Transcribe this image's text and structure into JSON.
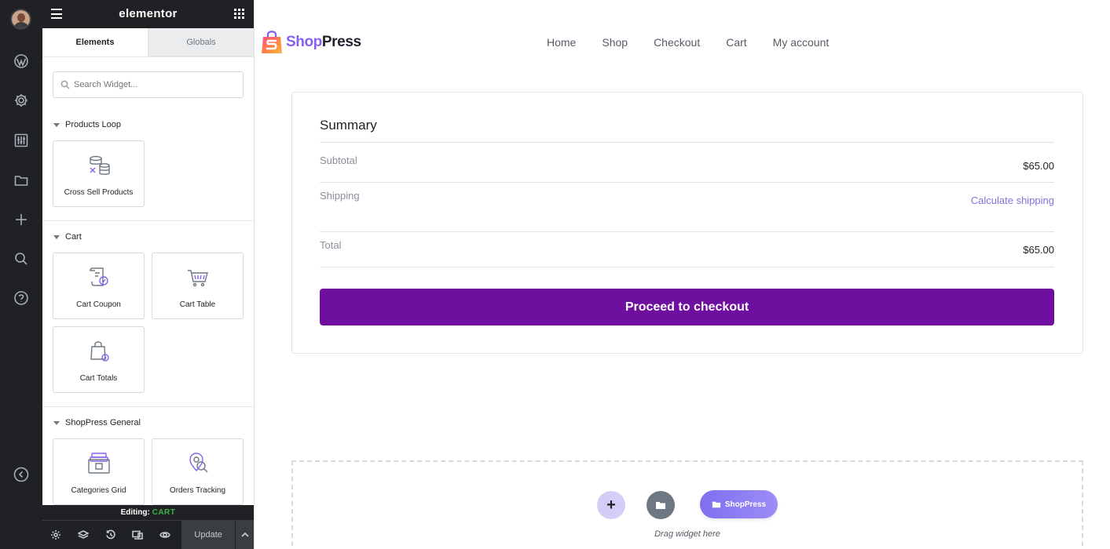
{
  "panel": {
    "brand": "elementor",
    "tabs": [
      "Elements",
      "Globals"
    ],
    "search_placeholder": "Search Widget...",
    "categories": [
      {
        "title": "Products Loop",
        "widgets": [
          "Cross Sell Products"
        ]
      },
      {
        "title": "Cart",
        "widgets": [
          "Cart Coupon",
          "Cart Table",
          "Cart Totals"
        ]
      },
      {
        "title": "ShopPress General",
        "widgets": [
          "Categories Grid",
          "Orders Tracking"
        ]
      }
    ],
    "editing_label": "Editing:",
    "editing_value": "CART",
    "update_label": "Update"
  },
  "site": {
    "logo_shop": "Shop",
    "logo_press": "Press",
    "nav": [
      "Home",
      "Shop",
      "Checkout",
      "Cart",
      "My account"
    ]
  },
  "summary": {
    "title": "Summary",
    "subtotal_label": "Subtotal",
    "subtotal_value": "$65.00",
    "shipping_label": "Shipping",
    "shipping_link": "Calculate shipping",
    "total_label": "Total",
    "total_value": "$65.00",
    "checkout_button": "Proceed to checkout"
  },
  "drop_area": {
    "add_symbol": "+",
    "shoppress_button": "ShopPress",
    "drag_text": "Drag widget here"
  },
  "colors": {
    "checkout_button": "#6f0fa0",
    "link": "#7d73e0",
    "editing_value": "#39b54a",
    "panel_dark": "#1f2124"
  }
}
